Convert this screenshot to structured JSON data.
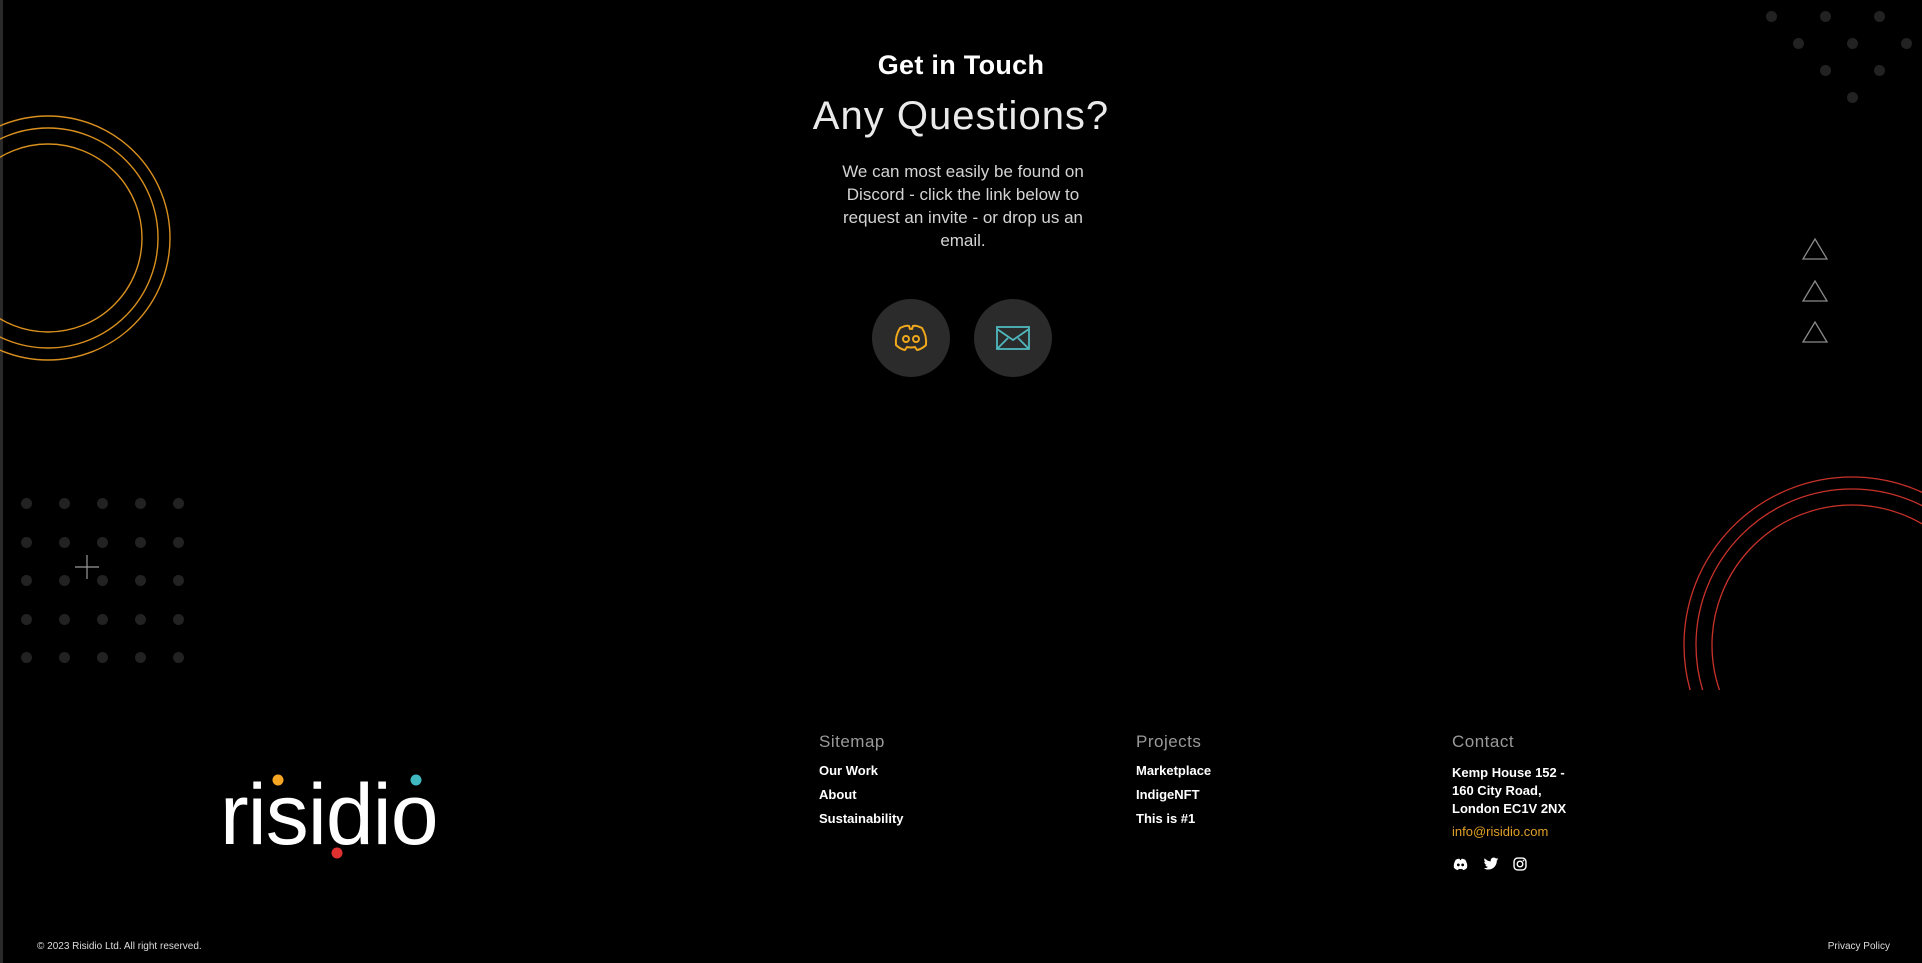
{
  "hero": {
    "eyebrow": "Get in Touch",
    "heading": "Any Questions?",
    "blurb": "We can most easily be found on Discord - click the link below to request an invite - or drop us an email."
  },
  "actions": [
    {
      "icon": "discord-icon",
      "color": "#f0a81c"
    },
    {
      "icon": "mail-icon",
      "color": "#4fb8be"
    }
  ],
  "logo": {
    "text": "risidio",
    "colors": {
      "dot_orange": "#f5a623",
      "dot_teal": "#3fb8c0",
      "dot_red": "#e03030"
    }
  },
  "footer": {
    "sitemap": {
      "title": "Sitemap",
      "links": [
        "Our Work",
        "About",
        "Sustainability"
      ]
    },
    "projects": {
      "title": "Projects",
      "links": [
        "Marketplace",
        "IndigeNFT",
        "This is #1"
      ]
    },
    "contact": {
      "title": "Contact",
      "address_lines": [
        "Kemp House 152 -",
        "160 City Road,",
        "London EC1V 2NX"
      ],
      "email": "info@risidio.com",
      "socials": [
        "discord-icon",
        "twitter-icon",
        "instagram-icon"
      ]
    },
    "copyright": "© 2023 Risidio Ltd. All right reserved.",
    "privacy": "Privacy Policy"
  },
  "colors": {
    "background": "#000000",
    "accent_orange": "#e0a028",
    "accent_teal": "#4fb8be",
    "accent_red": "#d33a2c"
  }
}
